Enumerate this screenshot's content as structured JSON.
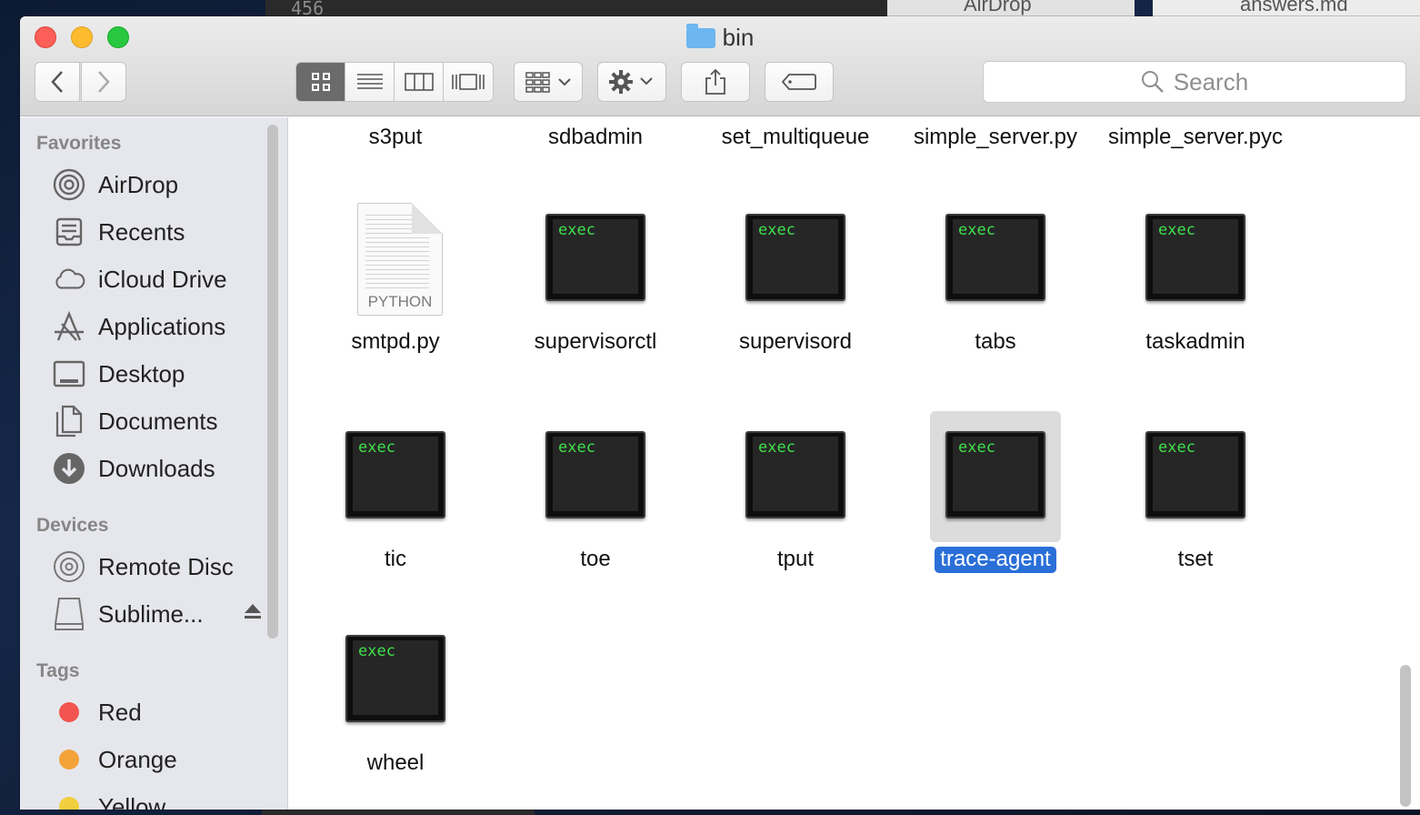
{
  "background": {
    "terminal_text": "456",
    "window_airdrop": "AirDrop",
    "window_answers": "answers.md"
  },
  "window": {
    "title": "bin"
  },
  "toolbar": {
    "back_icon": "chevron-left-icon",
    "forward_icon": "chevron-right-icon",
    "view_modes": [
      "icon-view",
      "list-view",
      "column-view",
      "cover-flow-view"
    ],
    "active_view": "icon-view",
    "search_placeholder": "Search"
  },
  "sidebar": {
    "favorites_header": "Favorites",
    "favorites": [
      {
        "label": "AirDrop",
        "icon": "airdrop-icon"
      },
      {
        "label": "Recents",
        "icon": "recents-icon"
      },
      {
        "label": "iCloud Drive",
        "icon": "cloud-icon"
      },
      {
        "label": "Applications",
        "icon": "applications-icon"
      },
      {
        "label": "Desktop",
        "icon": "desktop-icon"
      },
      {
        "label": "Documents",
        "icon": "documents-icon"
      },
      {
        "label": "Downloads",
        "icon": "downloads-icon"
      }
    ],
    "devices_header": "Devices",
    "devices": [
      {
        "label": "Remote Disc",
        "icon": "disc-icon"
      },
      {
        "label": "Sublime...",
        "icon": "drive-icon"
      }
    ],
    "tags_header": "Tags",
    "tags": [
      {
        "label": "Red",
        "color": "#f2544f"
      },
      {
        "label": "Orange",
        "color": "#f4a33b"
      },
      {
        "label": "Yellow",
        "color": "#f2cf3e"
      }
    ]
  },
  "files": {
    "row0": [
      "s3put",
      "sdbadmin",
      "set_multiqueue",
      "simple_server.py",
      "simple_server.pyc"
    ],
    "row1": [
      {
        "name": "smtpd.py",
        "kind": "python",
        "badge": "PYTHON"
      },
      {
        "name": "supervisorctl",
        "kind": "exec",
        "badge": "exec"
      },
      {
        "name": "supervisord",
        "kind": "exec",
        "badge": "exec"
      },
      {
        "name": "tabs",
        "kind": "exec",
        "badge": "exec"
      },
      {
        "name": "taskadmin",
        "kind": "exec",
        "badge": "exec"
      }
    ],
    "row2": [
      {
        "name": "tic",
        "kind": "exec",
        "badge": "exec"
      },
      {
        "name": "toe",
        "kind": "exec",
        "badge": "exec"
      },
      {
        "name": "tput",
        "kind": "exec",
        "badge": "exec"
      },
      {
        "name": "trace-agent",
        "kind": "exec",
        "badge": "exec",
        "selected": true
      },
      {
        "name": "tset",
        "kind": "exec",
        "badge": "exec"
      }
    ],
    "row3": [
      {
        "name": "wheel",
        "kind": "exec",
        "badge": "exec"
      }
    ]
  }
}
